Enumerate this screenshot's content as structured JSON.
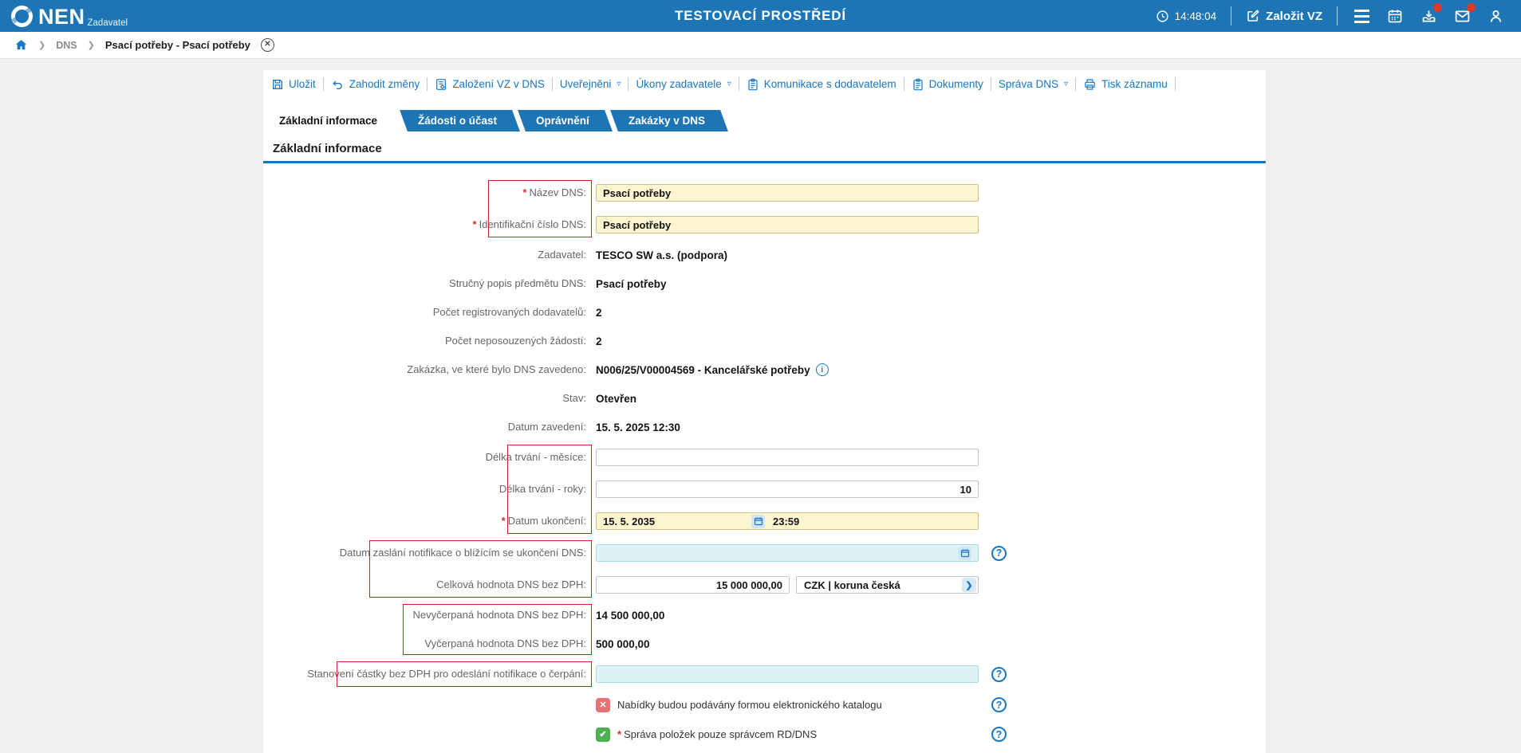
{
  "topbar": {
    "brand": "NEN",
    "brand_sub": "Zadavatel",
    "env_title": "TESTOVACÍ PROSTŘEDÍ",
    "time": "14:48:04",
    "create_vz_label": "Založit VZ"
  },
  "breadcrumb": {
    "items": [
      {
        "label": "DNS"
      },
      {
        "label": "Psací potřeby - Psací potřeby"
      }
    ]
  },
  "toolbar": {
    "items": [
      {
        "label": "Uložit",
        "icon": "save-icon"
      },
      {
        "label": "Zahodit změny",
        "icon": "discard-icon"
      },
      {
        "label": "Založení VZ v DNS",
        "icon": "document-gear-icon"
      },
      {
        "label": "Uveřejněni",
        "icon": "dropdown"
      },
      {
        "label": "Úkony zadavatele",
        "icon": "dropdown"
      },
      {
        "label": "Komunikace s dodavatelem",
        "icon": "clipboard-icon"
      },
      {
        "label": "Dokumenty",
        "icon": "clipboard-icon"
      },
      {
        "label": "Správa DNS",
        "icon": "dropdown"
      },
      {
        "label": "Tisk záznamu",
        "icon": "printer-icon"
      }
    ]
  },
  "tabs": [
    {
      "label": "Základní informace",
      "active": true
    },
    {
      "label": "Žádosti o účast",
      "active": false
    },
    {
      "label": "Oprávnění",
      "active": false
    },
    {
      "label": "Zakázky v DNS",
      "active": false
    }
  ],
  "section_title": "Základní informace",
  "form": {
    "rows": [
      {
        "req": "*",
        "label": "Název DNS:",
        "value": "Psací potřeby"
      },
      {
        "req": "*",
        "label": "Identifikační číslo DNS:",
        "value": "Psací potřeby"
      },
      {
        "label": "Zadavatel:",
        "value": "TESCO SW a.s. (podpora)"
      },
      {
        "label": "Stručný popis předmětu DNS:",
        "value": "Psací potřeby"
      },
      {
        "label": "Počet registrovaných dodavatelů:",
        "value": "2"
      },
      {
        "label": "Počet neposouzených žádostí:",
        "value": "2"
      },
      {
        "label": "Zakázka, ve které bylo DNS zavedeno:",
        "value": "N006/25/V00004569 - Kancelářské potřeby"
      },
      {
        "label": "Stav:",
        "value": "Otevřen"
      },
      {
        "label": "Datum zavedení:",
        "value": "15. 5. 2025 12:30"
      },
      {
        "label": "Délka trvání - měsíce:",
        "value": ""
      },
      {
        "label": "Délka trvání - roky:",
        "value": "10"
      },
      {
        "req": "*",
        "label": "Datum ukončení:",
        "date": "15. 5. 2035",
        "time": "23:59"
      },
      {
        "label": "Datum zaslání notifikace o blížícím se ukončení DNS:",
        "value": ""
      },
      {
        "label": "Celková hodnota DNS bez DPH:",
        "value": "15 000 000,00",
        "currency": "CZK | koruna česká"
      },
      {
        "label": "Nevyčerpaná hodnota DNS bez DPH:",
        "value": "14 500 000,00"
      },
      {
        "label": "Vyčerpaná hodnota DNS bez DPH:",
        "value": "500 000,00"
      },
      {
        "label": "Stanovení částky bez DPH pro odeslání notifikace o čerpání:",
        "value": ""
      }
    ]
  },
  "checkboxes": [
    {
      "checked": false,
      "label": "Nabídky budou podávány formou elektronického katalogu"
    },
    {
      "checked": true,
      "req": "*",
      "label": "Správa položek pouze správcem RD/DNS"
    }
  ],
  "colors": {
    "header_blue": "#1e75b5",
    "link_blue": "#1777c2",
    "required_red": "#d32f2f",
    "frame_red": "#cf2323",
    "badge_red": "#d93a2b",
    "input_yellow": "#fcf6d0",
    "input_cyan": "#ddf3f6",
    "checkbox_green": "#4caf50",
    "checkbox_red": "#e57373"
  }
}
